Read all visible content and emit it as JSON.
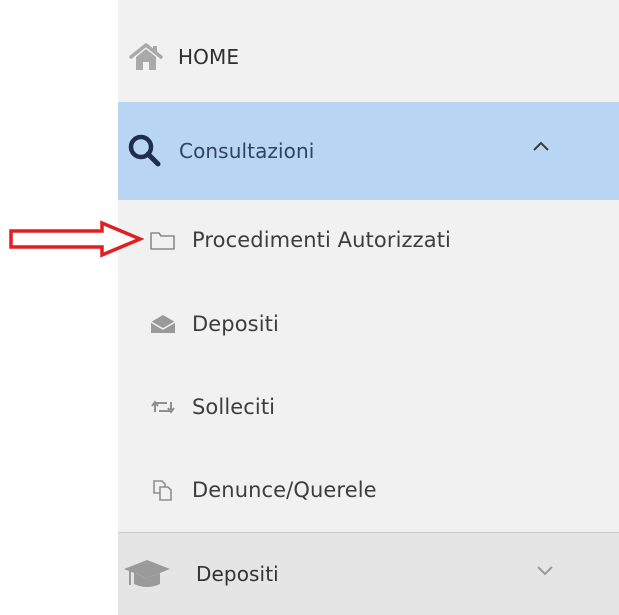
{
  "sidebar": {
    "home": {
      "label": "HOME",
      "icon": "home-icon"
    },
    "consultazioni": {
      "label": "Consultazioni",
      "icon": "search-icon",
      "expanded": true,
      "highlight_color": "#b8d5f4",
      "items": [
        {
          "label": "Procedimenti Autorizzati",
          "icon": "folder-icon"
        },
        {
          "label": "Depositi",
          "icon": "envelope-open-icon"
        },
        {
          "label": "Solleciti",
          "icon": "retweet-icon"
        },
        {
          "label": "Denunce/Querele",
          "icon": "copy-icon"
        }
      ]
    },
    "depositi_section": {
      "label": "Depositi",
      "icon": "graduation-cap-icon",
      "expanded": false
    }
  },
  "annotation": {
    "type": "red-arrow",
    "color": "#e02020"
  }
}
